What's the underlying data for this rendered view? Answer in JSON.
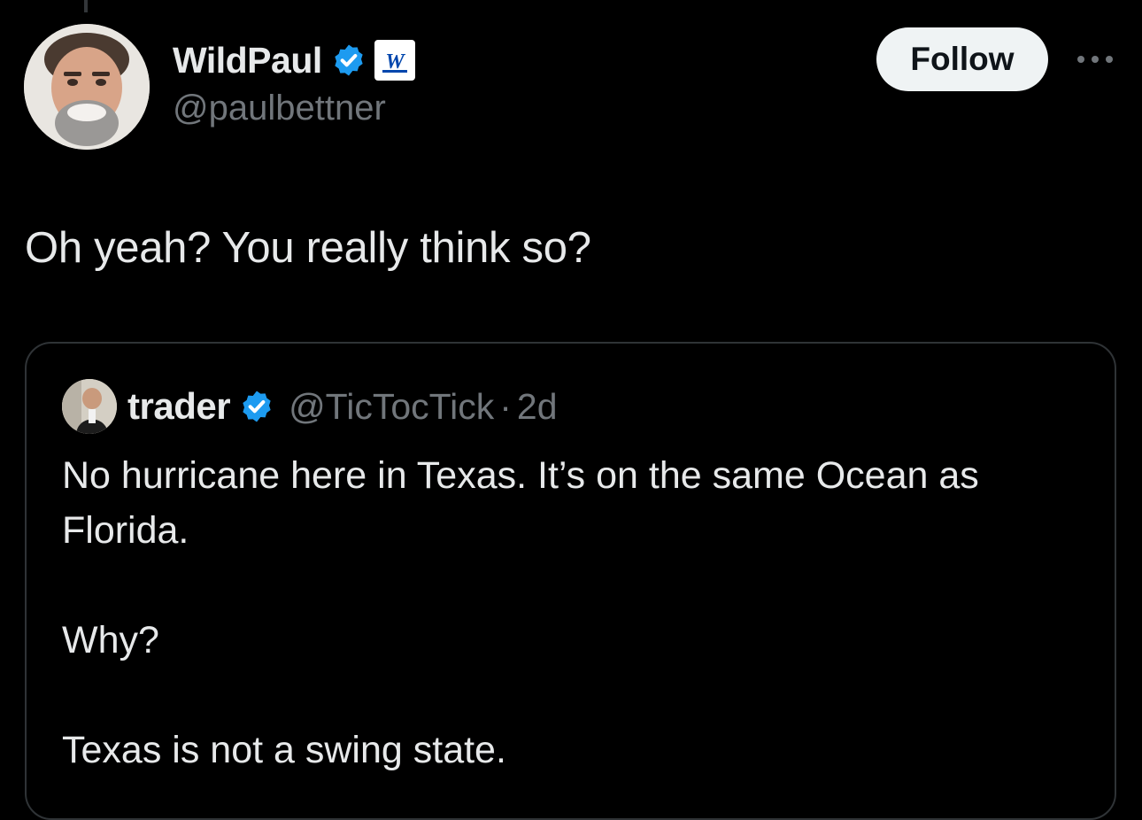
{
  "author": {
    "display_name": "WildPaul",
    "handle": "@paulbettner",
    "affiliate_badge": "W",
    "verified_icon": "verified-badge-icon"
  },
  "actions": {
    "follow_label": "Follow",
    "more_icon": "more-options-icon"
  },
  "tweet": {
    "text": "Oh yeah? You really think so?"
  },
  "quote": {
    "display_name": "trader",
    "handle": "@TicTocTick",
    "separator": "·",
    "time": "2d",
    "text": "No hurricane here in Texas. It’s on the same Ocean as Florida.\n\nWhy?\n\nTexas is not a swing state."
  },
  "colors": {
    "background": "#000000",
    "primary_text": "#e7e9ea",
    "secondary_text": "#71767b",
    "verified_blue": "#1d9bf0",
    "affiliate_blue": "#0046ad",
    "border": "#2f3336",
    "follow_bg": "#eff3f4"
  }
}
